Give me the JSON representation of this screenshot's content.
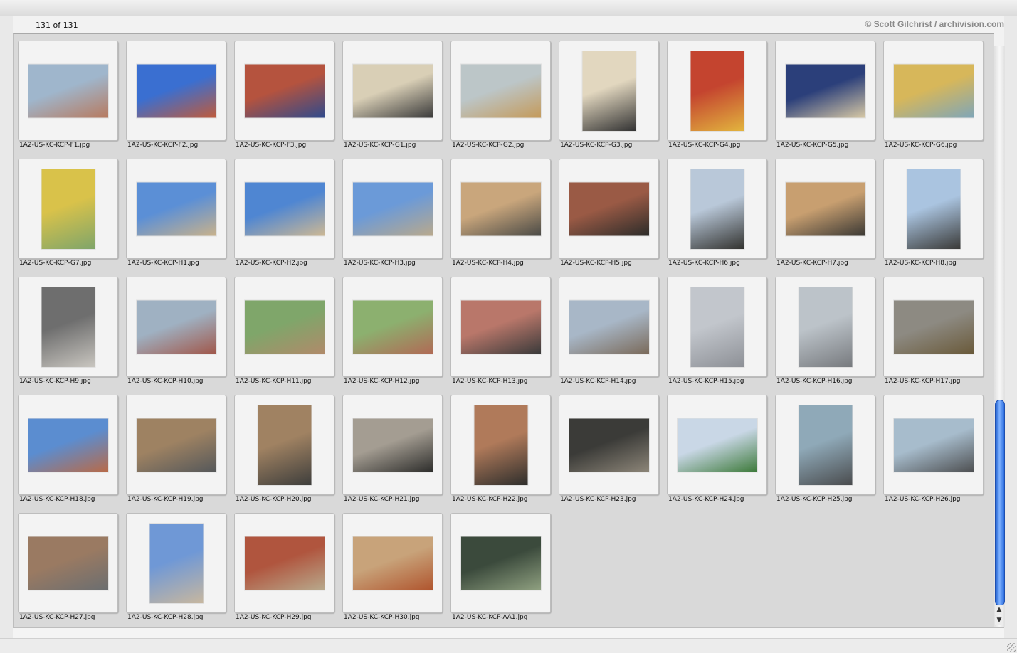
{
  "header": {
    "count_label": "131 of 131",
    "credit": "© Scott Gilchrist / archivision.com"
  },
  "thumbnails": [
    {
      "caption": "1A2-US-KC-KCP-F1.jpg",
      "o": "l",
      "c1": "#9fb6cc",
      "c2": "#b77a5f"
    },
    {
      "caption": "1A2-US-KC-KCP-F2.jpg",
      "o": "l",
      "c1": "#3a6fd1",
      "c2": "#c05a3a"
    },
    {
      "caption": "1A2-US-KC-KCP-F3.jpg",
      "o": "l",
      "c1": "#b5533e",
      "c2": "#2f4a8c"
    },
    {
      "caption": "1A2-US-KC-KCP-G1.jpg",
      "o": "l",
      "c1": "#d9cfb6",
      "c2": "#3a3a3a"
    },
    {
      "caption": "1A2-US-KC-KCP-G2.jpg",
      "o": "l",
      "c1": "#bcc6c8",
      "c2": "#c49a5a"
    },
    {
      "caption": "1A2-US-KC-KCP-G3.jpg",
      "o": "p",
      "c1": "#e2d7bf",
      "c2": "#333333"
    },
    {
      "caption": "1A2-US-KC-KCP-G4.jpg",
      "o": "p",
      "c1": "#c4442f",
      "c2": "#e2b43e"
    },
    {
      "caption": "1A2-US-KC-KCP-G5.jpg",
      "o": "l",
      "c1": "#2b3f7a",
      "c2": "#d8c9a5"
    },
    {
      "caption": "1A2-US-KC-KCP-G6.jpg",
      "o": "l",
      "c1": "#d7b75a",
      "c2": "#7fa6b8"
    },
    {
      "caption": "1A2-US-KC-KCP-G7.jpg",
      "o": "p",
      "c1": "#d9c24a",
      "c2": "#7fa56a"
    },
    {
      "caption": "1A2-US-KC-KCP-H1.jpg",
      "o": "l",
      "c1": "#5b8fd6",
      "c2": "#c9b28b"
    },
    {
      "caption": "1A2-US-KC-KCP-H2.jpg",
      "o": "l",
      "c1": "#4f86d2",
      "c2": "#cdb894"
    },
    {
      "caption": "1A2-US-KC-KCP-H3.jpg",
      "o": "l",
      "c1": "#6b9ad8",
      "c2": "#b9a98c"
    },
    {
      "caption": "1A2-US-KC-KCP-H4.jpg",
      "o": "l",
      "c1": "#c9a67c",
      "c2": "#4a4a46"
    },
    {
      "caption": "1A2-US-KC-KCP-H5.jpg",
      "o": "l",
      "c1": "#9a5a45",
      "c2": "#2c2c2a"
    },
    {
      "caption": "1A2-US-KC-KCP-H6.jpg",
      "o": "p",
      "c1": "#b9c8d9",
      "c2": "#333330"
    },
    {
      "caption": "1A2-US-KC-KCP-H7.jpg",
      "o": "l",
      "c1": "#c89f70",
      "c2": "#3a3834"
    },
    {
      "caption": "1A2-US-KC-KCP-H8.jpg",
      "o": "p",
      "c1": "#aac4e0",
      "c2": "#3a3a38"
    },
    {
      "caption": "1A2-US-KC-KCP-H9.jpg",
      "o": "p",
      "c1": "#6e6e6e",
      "c2": "#c9c6c0"
    },
    {
      "caption": "1A2-US-KC-KCP-H10.jpg",
      "o": "l",
      "c1": "#9fb1c2",
      "c2": "#a0574a"
    },
    {
      "caption": "1A2-US-KC-KCP-H11.jpg",
      "o": "l",
      "c1": "#7fa66a",
      "c2": "#b08a6a"
    },
    {
      "caption": "1A2-US-KC-KCP-H12.jpg",
      "o": "l",
      "c1": "#8cb06f",
      "c2": "#b06a55"
    },
    {
      "caption": "1A2-US-KC-KCP-H13.jpg",
      "o": "l",
      "c1": "#b9776a",
      "c2": "#3a3a3a"
    },
    {
      "caption": "1A2-US-KC-KCP-H14.jpg",
      "o": "l",
      "c1": "#a8b7c7",
      "c2": "#7a6a5a"
    },
    {
      "caption": "1A2-US-KC-KCP-H15.jpg",
      "o": "p",
      "c1": "#c2c6cc",
      "c2": "#8d9096"
    },
    {
      "caption": "1A2-US-KC-KCP-H16.jpg",
      "o": "p",
      "c1": "#bcc3c9",
      "c2": "#777a7e"
    },
    {
      "caption": "1A2-US-KC-KCP-H17.jpg",
      "o": "l",
      "c1": "#8d8a82",
      "c2": "#6a5a3a"
    },
    {
      "caption": "1A2-US-KC-KCP-H18.jpg",
      "o": "l",
      "c1": "#5b8dd0",
      "c2": "#b86a48"
    },
    {
      "caption": "1A2-US-KC-KCP-H19.jpg",
      "o": "l",
      "c1": "#9e8262",
      "c2": "#55585a"
    },
    {
      "caption": "1A2-US-KC-KCP-H20.jpg",
      "o": "p",
      "c1": "#a08262",
      "c2": "#3e3e3c"
    },
    {
      "caption": "1A2-US-KC-KCP-H21.jpg",
      "o": "l",
      "c1": "#a49d92",
      "c2": "#2e2e2c"
    },
    {
      "caption": "1A2-US-KC-KCP-H22.jpg",
      "o": "p",
      "c1": "#b07a5a",
      "c2": "#2e2e2c"
    },
    {
      "caption": "1A2-US-KC-KCP-H23.jpg",
      "o": "l",
      "c1": "#3b3b38",
      "c2": "#8c8578"
    },
    {
      "caption": "1A2-US-KC-KCP-H24.jpg",
      "o": "l",
      "c1": "#c9d7e6",
      "c2": "#3d7a3a"
    },
    {
      "caption": "1A2-US-KC-KCP-H25.jpg",
      "o": "p",
      "c1": "#8fa9b8",
      "c2": "#4a4c4e"
    },
    {
      "caption": "1A2-US-KC-KCP-H26.jpg",
      "o": "l",
      "c1": "#a7bccc",
      "c2": "#4e5052"
    },
    {
      "caption": "1A2-US-KC-KCP-H27.jpg",
      "o": "l",
      "c1": "#9a7a62",
      "c2": "#6b6e70"
    },
    {
      "caption": "1A2-US-KC-KCP-H28.jpg",
      "o": "p",
      "c1": "#6f98d6",
      "c2": "#c7b79f"
    },
    {
      "caption": "1A2-US-KC-KCP-H29.jpg",
      "o": "l",
      "c1": "#b0553e",
      "c2": "#b8a98c"
    },
    {
      "caption": "1A2-US-KC-KCP-H30.jpg",
      "o": "l",
      "c1": "#c8a37a",
      "c2": "#b0552e"
    },
    {
      "caption": "1A2-US-KC-KCP-AA1.jpg",
      "o": "l",
      "c1": "#3b4a3c",
      "c2": "#8fa080"
    }
  ]
}
